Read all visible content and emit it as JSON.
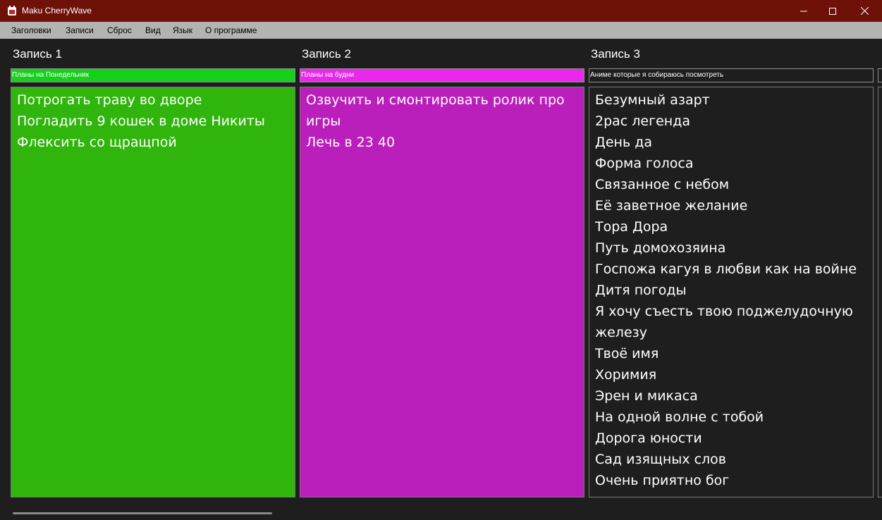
{
  "window": {
    "title": "Maku CherryWave",
    "minimize_icon": "minimize-icon",
    "maximize_icon": "maximize-icon",
    "close_icon": "close-icon",
    "titlebar_color": "#6e1109"
  },
  "menu": {
    "items": [
      "Заголовки",
      "Записи",
      "Сброс",
      "Вид",
      "Язык",
      "О программе"
    ]
  },
  "notes": [
    {
      "heading": "Запись 1",
      "subtitle": "Планы на Понедельник",
      "subtitle_bg": "#16d01c",
      "area_bg": "#30b50c",
      "lines": [
        "Потрогать траву во дворе",
        "Погладить 9 кошек в доме Никиты",
        "Флексить со щращпой"
      ]
    },
    {
      "heading": "Запись 2",
      "subtitle": "Планы на будни",
      "subtitle_bg": "#e928eb",
      "area_bg": "#bb1fbb",
      "lines": [
        "Озвучить и смонтировать ролик про игры",
        "Лечь в 23 40"
      ]
    },
    {
      "heading": "Запись 3",
      "subtitle": "Аниме которые я собираюсь посмотреть",
      "subtitle_bg": "#1e1e1e",
      "area_bg": "#1e1e1e",
      "lines": [
        "Безумный азарт",
        "2рас легенда",
        "День да",
        "Форма голоса",
        "Связанное с небом",
        "Её заветное желание",
        "Тора Дора",
        "Путь домохозяина",
        "Госпожа кагуя в любви как на войне",
        "Дитя погоды",
        "Я хочу съесть твою поджелудочную железу",
        "Твоё имя",
        "Хоримия",
        "Эрен и микаса",
        "На одной волне с тобой",
        "Дорога юности",
        "Сад изящных слов",
        "Очень приятно бог"
      ]
    }
  ]
}
